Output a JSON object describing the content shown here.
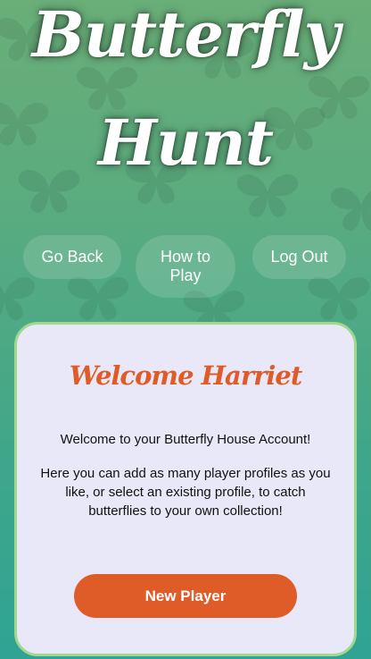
{
  "header": {
    "title_line_1": "Butterfly",
    "title_line_2": "Hunt"
  },
  "nav": {
    "back_label": "Go Back",
    "how_to_play_label": "How to Play",
    "log_out_label": "Log Out"
  },
  "card": {
    "heading": "Welcome Harriet",
    "welcome_text": "Welcome to your Butterfly House Account!",
    "info_text": "Here you can add as many player profiles as you like, or select an existing profile, to catch butterflies to your own collection!",
    "new_player_label": "New Player"
  },
  "colors": {
    "accent": "#df5b27",
    "card_background": "#e8e8f8",
    "card_border": "#9fd88e"
  }
}
